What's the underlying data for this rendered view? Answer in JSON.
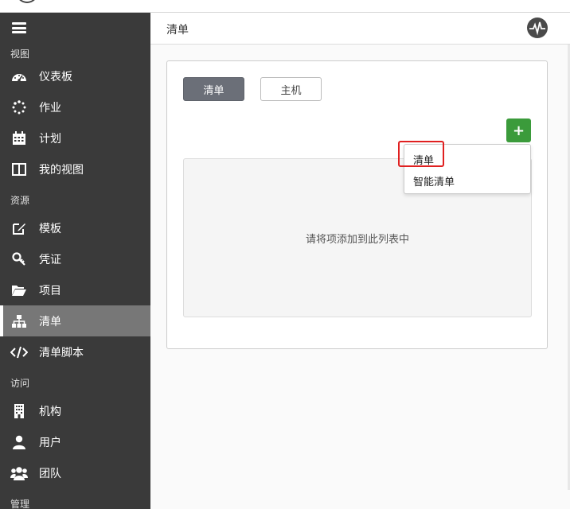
{
  "sidebar": {
    "sections": {
      "view": "视图",
      "resources": "资源",
      "access": "访问",
      "admin": "管理"
    },
    "items": [
      {
        "label": "仪表板",
        "icon": "dashboard-icon"
      },
      {
        "label": "作业",
        "icon": "jobs-spinner-icon"
      },
      {
        "label": "计划",
        "icon": "calendar-icon"
      },
      {
        "label": "我的视图",
        "icon": "columns-icon"
      },
      {
        "label": "模板",
        "icon": "edit-icon"
      },
      {
        "label": "凭证",
        "icon": "key-icon"
      },
      {
        "label": "项目",
        "icon": "folder-open-icon"
      },
      {
        "label": "清单",
        "icon": "sitemap-icon",
        "active": true
      },
      {
        "label": "清单脚本",
        "icon": "code-icon"
      },
      {
        "label": "机构",
        "icon": "building-icon"
      },
      {
        "label": "用户",
        "icon": "user-icon"
      },
      {
        "label": "团队",
        "icon": "users-icon"
      }
    ]
  },
  "header": {
    "title": "清单",
    "activity_icon": "activity-pulse-icon"
  },
  "card": {
    "tabs": [
      {
        "label": "清单",
        "active": true
      },
      {
        "label": "主机",
        "active": false
      }
    ],
    "add_button": "+",
    "empty_message": "请将项添加到此列表中"
  },
  "dropdown": {
    "options": [
      "清单",
      "智能清单"
    ]
  },
  "colors": {
    "sidebar_bg": "#3a3a3a",
    "active_item_bg": "#777777",
    "add_button": "#3b9b3b",
    "highlight": "#e02020"
  }
}
